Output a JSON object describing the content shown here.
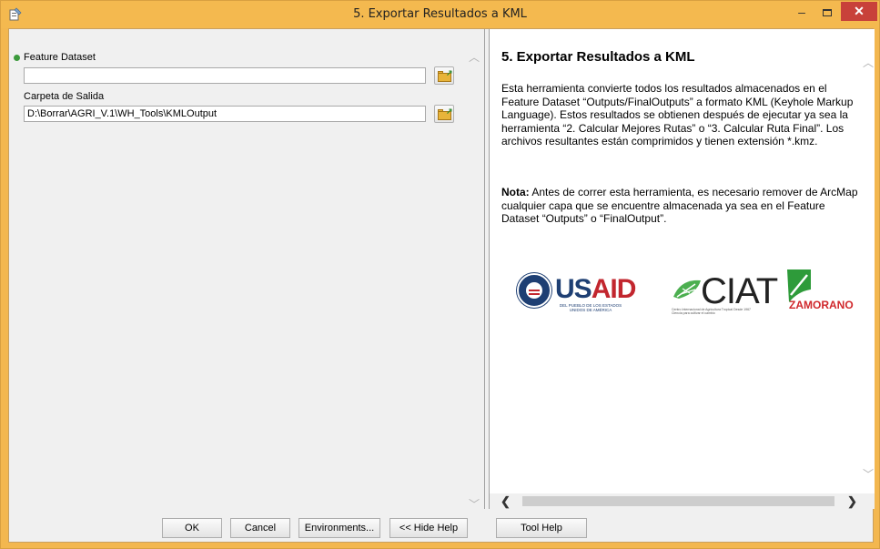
{
  "window": {
    "title": "5. Exportar Resultados a KML",
    "minimize_symbol": "–",
    "close_symbol": "✕"
  },
  "params": {
    "feature_dataset": {
      "label": "Feature Dataset",
      "value": "",
      "required": true
    },
    "output_folder": {
      "label": "Carpeta de Salida",
      "value": "D:\\Borrar\\AGRI_V.1\\WH_Tools\\KMLOutput"
    }
  },
  "help": {
    "title": "5. Exportar Resultados a KML",
    "paragraph1": "Esta herramienta convierte todos los resultados almacenados en el Feature Dataset “Outputs/FinalOutputs” a formato KML (Keyhole Markup Language). Estos resultados se obtienen después de ejecutar ya sea la herramienta “2. Calcular Mejores Rutas” o “3. Calcular Ruta Final”. Los archivos resultantes están comprimidos y tienen extensión *.kmz.",
    "note_label": "Nota:",
    "note_text": " Antes de correr esta herramienta, es necesario remover de ArcMap cualquier capa que se encuentre almacenada ya sea en el Feature Dataset “Outputs” o “FinalOutput”.",
    "logos": {
      "usaid": {
        "word_us": "US",
        "word_aid": "AID",
        "subtitle": "DEL PUEBLO DE LOS ESTADOS UNIDOS DE AMÉRICA"
      },
      "ciat": {
        "word": "CIAT",
        "subtitle": "Centro Internacional de Agricultura Tropical Desde 1967 Ciencia para cultivar el cambio"
      },
      "zamorano": {
        "word": "ZAMORANO"
      }
    }
  },
  "buttons": {
    "ok": "OK",
    "cancel": "Cancel",
    "environments": "Environments...",
    "hide_help": "<< Hide Help",
    "tool_help": "Tool Help"
  },
  "colors": {
    "titlebar": "#f4b94f",
    "close": "#c8413a",
    "usaid_blue": "#1e3f73",
    "usaid_red": "#c2262e",
    "ciat_green": "#4caf50",
    "zamorano_red": "#d0282c"
  }
}
